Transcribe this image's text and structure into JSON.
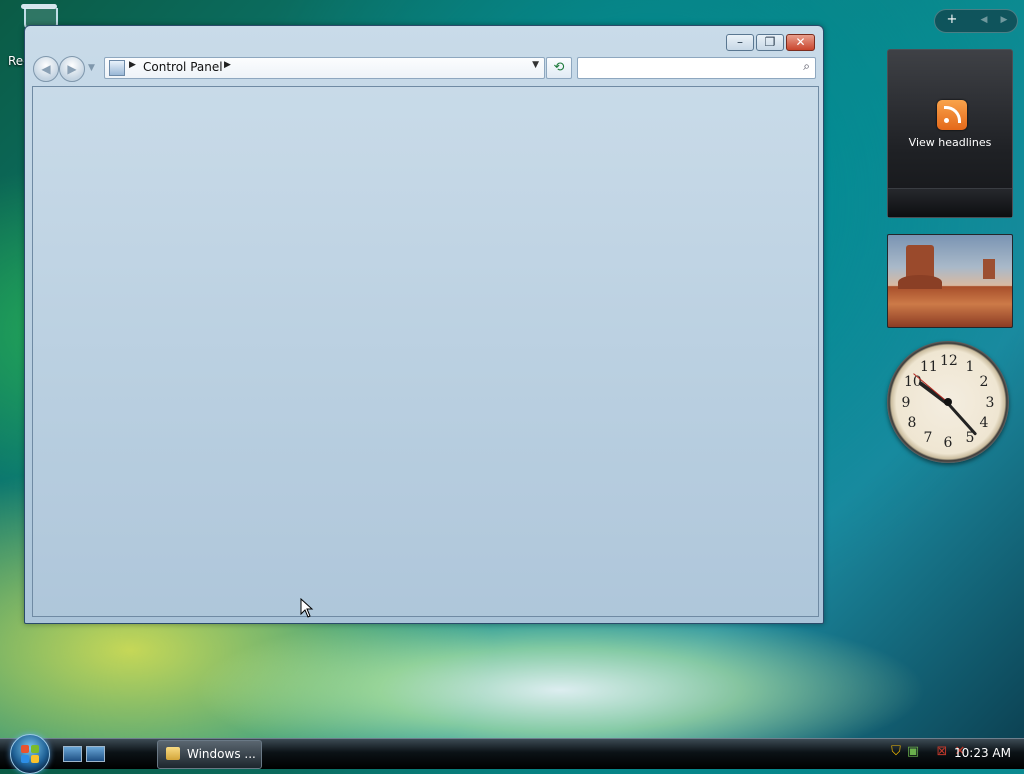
{
  "desktop": {
    "recycle_bin_label": "Rec"
  },
  "explorer": {
    "address": {
      "crumb": "Control Panel",
      "separator_glyph": "▶",
      "dropdown_glyph": "▼"
    },
    "search": {
      "placeholder": "",
      "value": ""
    },
    "controls": {
      "minimize_glyph": "–",
      "maximize_glyph": "❐",
      "close_glyph": "✕"
    },
    "nav": {
      "back_glyph": "◀",
      "forward_glyph": "▶",
      "history_glyph": "▼"
    },
    "refresh_glyph": "⟲",
    "search_glyph": "⌕"
  },
  "sidebar": {
    "toolbar": {
      "add_glyph": "+",
      "prev_glyph": "◀",
      "next_glyph": "▶"
    },
    "feed_gadget": {
      "label": "View headlines"
    },
    "clock": {
      "numbers": [
        "12",
        "1",
        "2",
        "3",
        "4",
        "5",
        "6",
        "7",
        "8",
        "9",
        "10",
        "11"
      ]
    }
  },
  "taskbar": {
    "task_button_label": "Windows ...",
    "time": "10:23 AM",
    "tray_icons": [
      "security-shield-icon",
      "network-icon",
      "network-disconnected-icon",
      "volume-muted-icon"
    ]
  },
  "colors": {
    "accent": "#1e5f94",
    "rss_orange": "#e4681a",
    "close_red": "#c9452d"
  }
}
